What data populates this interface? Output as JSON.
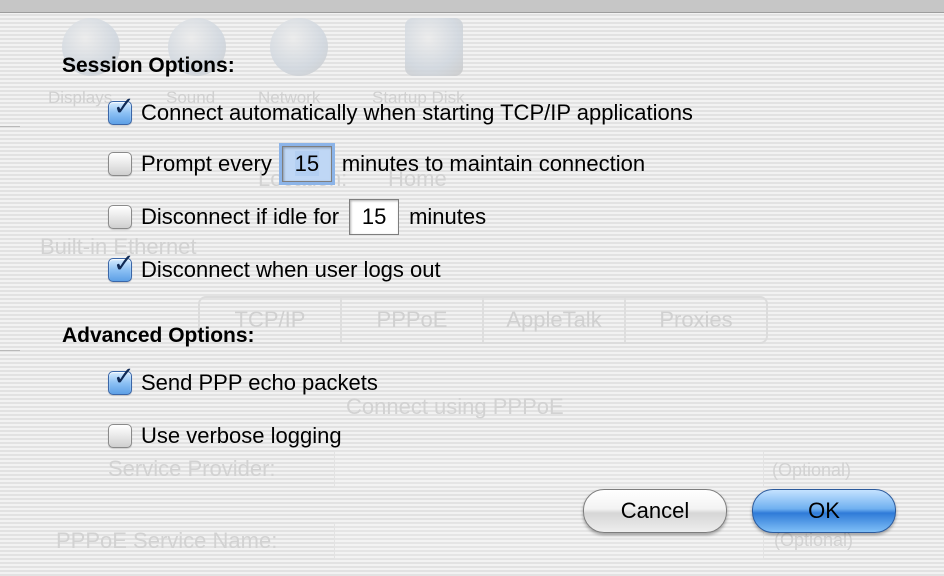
{
  "background_window": {
    "toolbar_labels": [
      "Displays",
      "Sound",
      "Network",
      "Startup Disk"
    ],
    "location_label": "Location:",
    "location_value": "Home",
    "show_label": "Built-in Ethernet",
    "tabs": [
      "TCP/IP",
      "PPPoE",
      "AppleTalk",
      "Proxies"
    ],
    "connect_pppoe": "Connect using PPPoE",
    "service_provider_label": "Service Provider:",
    "service_name_label": "PPPoE Service Name:",
    "optional_1": "(Optional)",
    "optional_2": "(Optional)"
  },
  "session": {
    "title": "Session Options:",
    "connect_auto": {
      "label": "Connect automatically when starting TCP/IP applications",
      "checked": true
    },
    "prompt": {
      "prefix": "Prompt every",
      "value": "15",
      "suffix": "minutes to maintain connection",
      "checked": false
    },
    "idle": {
      "prefix": "Disconnect if idle for",
      "value": "15",
      "suffix": "minutes",
      "checked": false
    },
    "logout": {
      "label": "Disconnect when user logs out",
      "checked": true
    }
  },
  "advanced": {
    "title": "Advanced Options:",
    "echo": {
      "label": "Send PPP echo packets",
      "checked": true
    },
    "verbose": {
      "label": "Use verbose logging",
      "checked": false
    }
  },
  "buttons": {
    "cancel": "Cancel",
    "ok": "OK"
  },
  "colors": {
    "accent_blue": "#5ea0e6",
    "ok_button": "#2f7bd8"
  }
}
